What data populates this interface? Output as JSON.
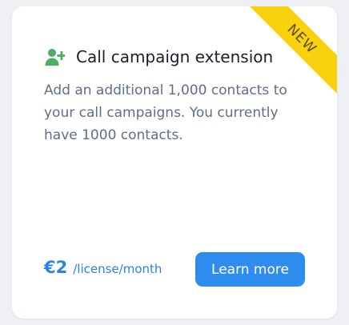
{
  "card": {
    "badge": "NEW",
    "icon": "add-user-icon",
    "title": "Call campaign extension",
    "description": "Add an additional 1,000 contacts to your call campaigns. You currently have 1000 contacts.",
    "price": {
      "amount": "€2",
      "unit": "/license/month"
    },
    "button_label": "Learn more"
  },
  "colors": {
    "badge": "#f8d20f",
    "icon": "#4caf64",
    "accent": "#2f8cef",
    "price": "#2f7fe8",
    "description": "#5f6f85"
  }
}
